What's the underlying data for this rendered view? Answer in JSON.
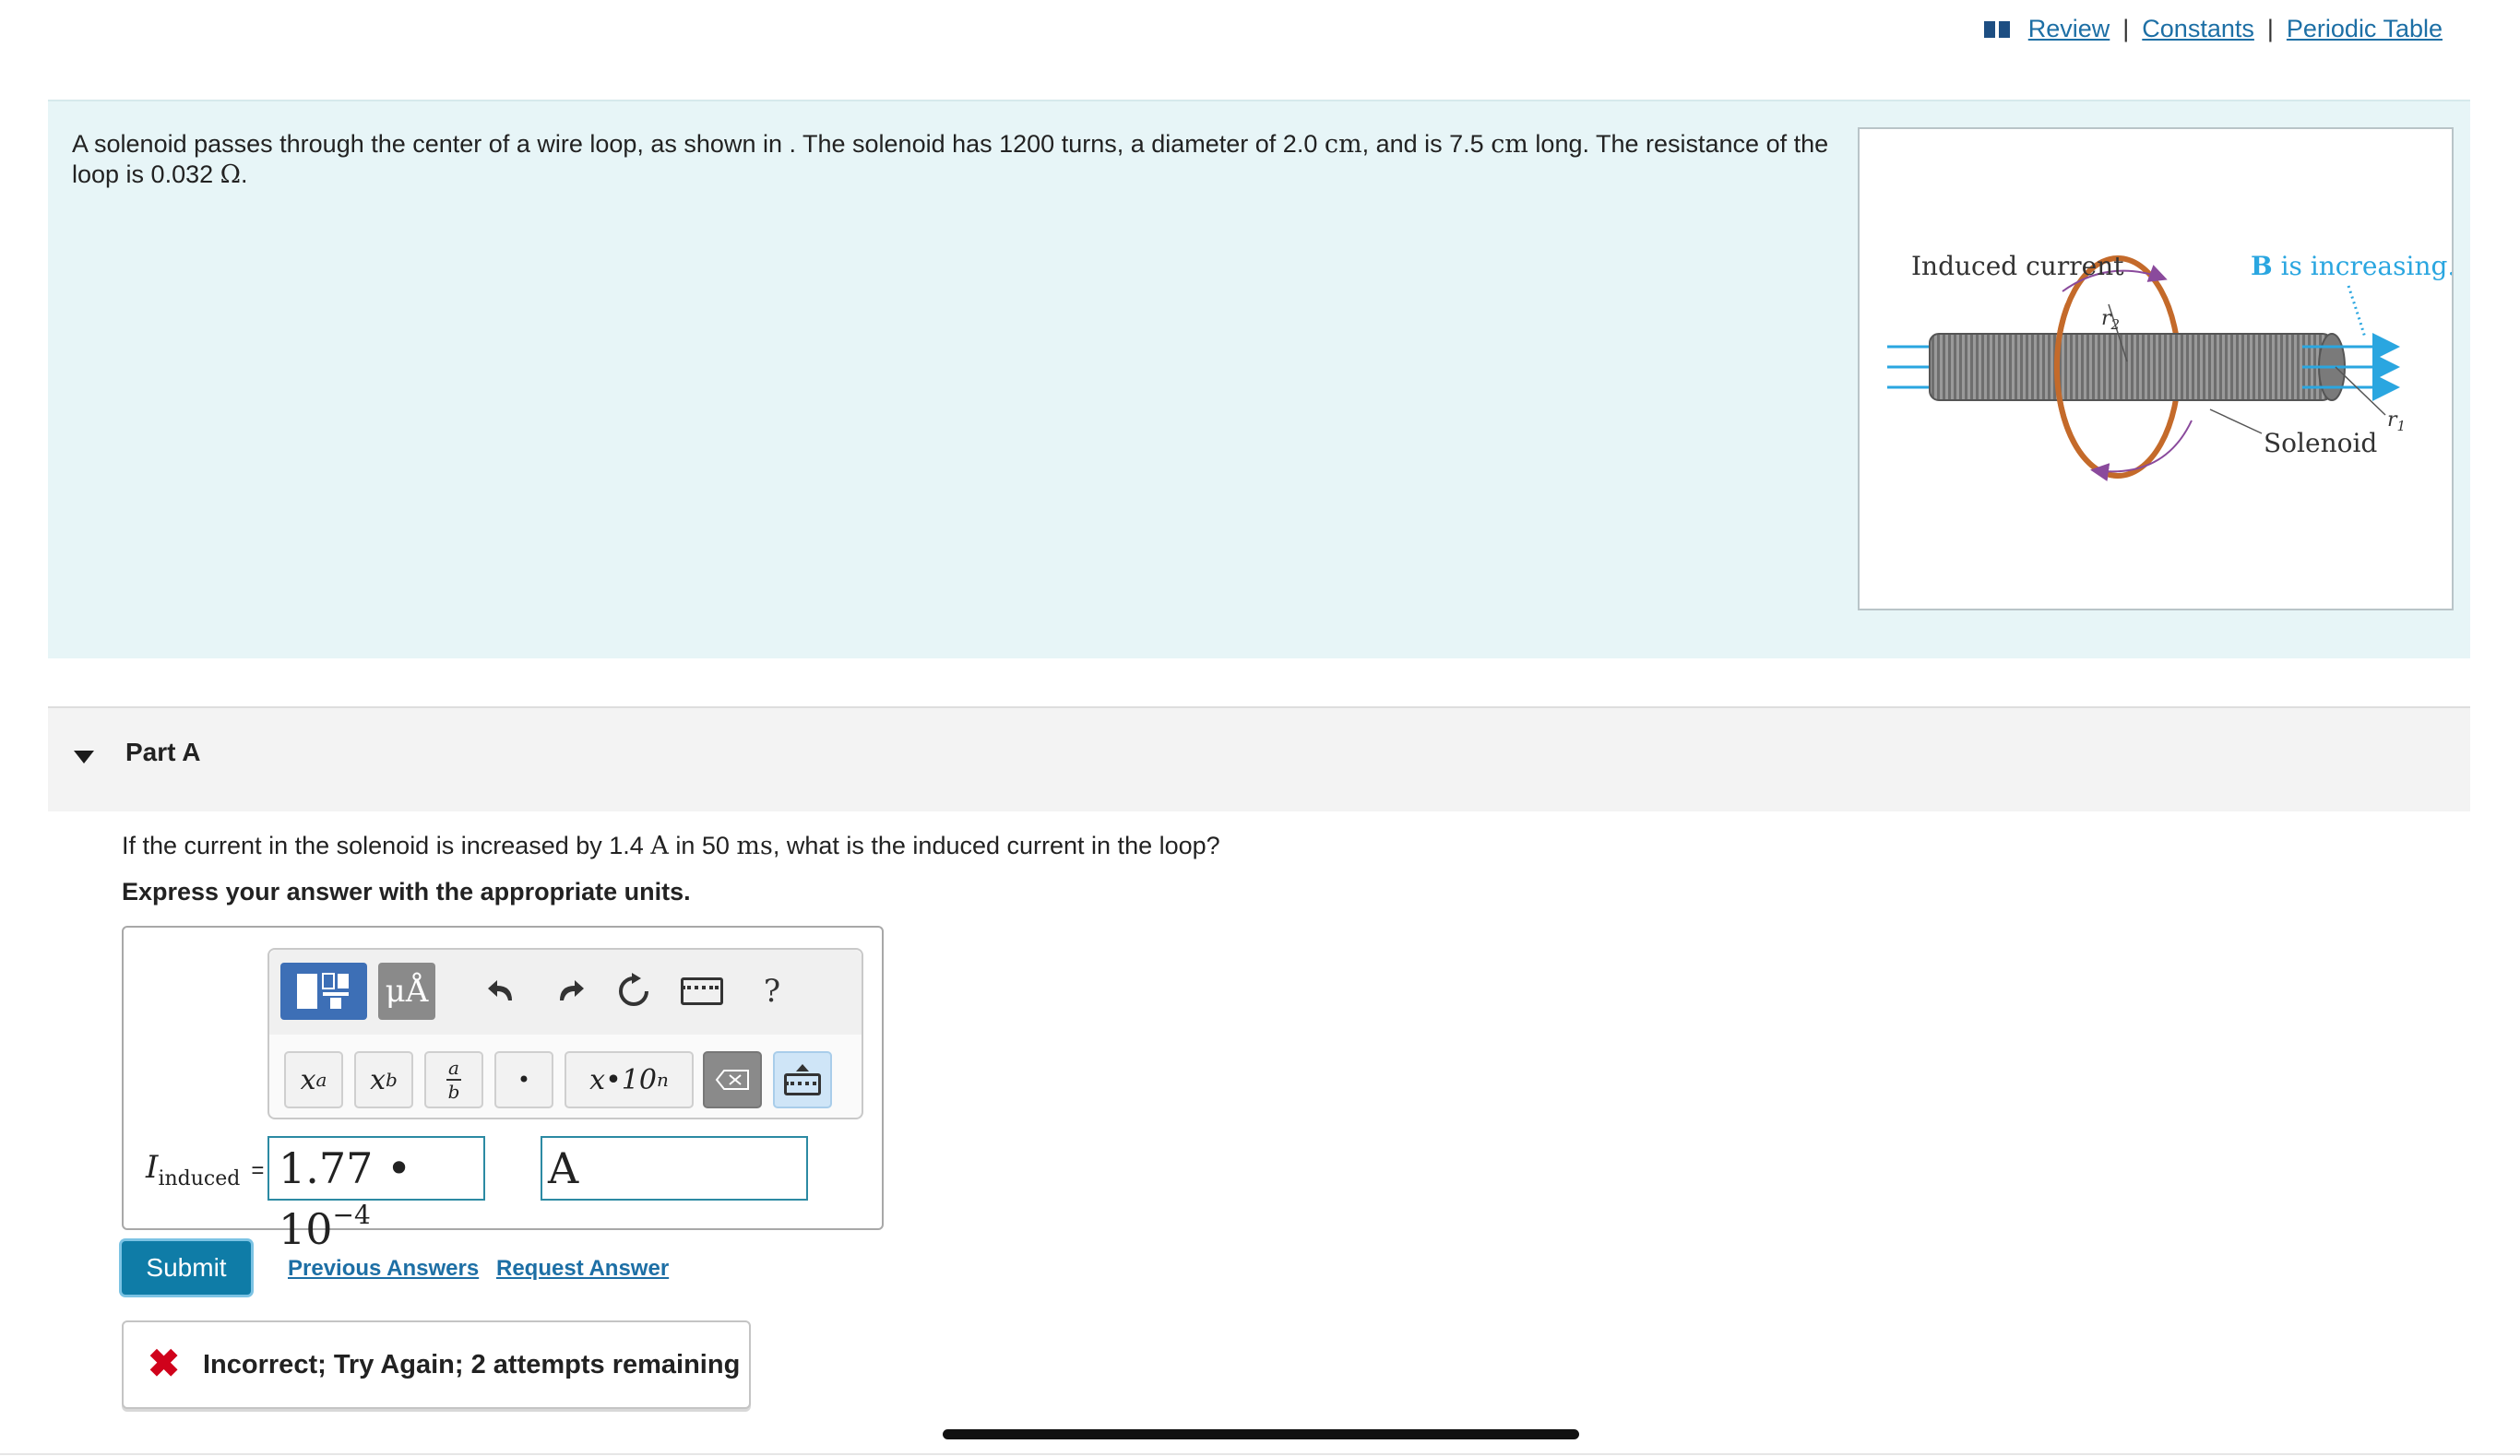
{
  "top_links": {
    "review": "Review",
    "constants": "Constants",
    "periodic_table": "Periodic Table"
  },
  "intro": {
    "text_a": "A solenoid passes through the center of a wire loop, as shown in . The solenoid has 1200 turns, a diameter of 2.0 ",
    "unit_cm1": "cm",
    "text_b": ", and is 7.5 ",
    "unit_cm2": "cm",
    "text_c": " long. The resistance of the loop is 0.032 ",
    "unit_ohm": "Ω",
    "text_d": "."
  },
  "figure": {
    "label_induced": "Induced current",
    "label_b_vec": "B",
    "label_b_rest": " is increasing.",
    "label_r2": "r",
    "label_r2_sub": "2",
    "label_r1": "r",
    "label_r1_sub": "1",
    "label_solenoid": "Solenoid",
    "colors": {
      "loop": "#c46a2a",
      "field": "#2aa6e0",
      "arrow": "#8a4a9c",
      "coil": "#8f8f8f"
    }
  },
  "part": {
    "title": "Part A",
    "question_a": "If the current in the solenoid is increased by 1.4 ",
    "unit_A": "A",
    "question_b": " in 50 ",
    "unit_ms": "ms",
    "question_c": ", what is the induced current in the loop?",
    "instruction": "Express your answer with the appropriate units."
  },
  "toolbar": {
    "units_label": "μÅ",
    "help_label": "?",
    "superscript_label": "x",
    "superscript_sup": "a",
    "subscript_label": "x",
    "subscript_sub": "b",
    "fraction_num": "a",
    "fraction_den": "b",
    "dot_label": "•",
    "sci_label": "x•10",
    "sci_sup": "n"
  },
  "answer": {
    "label_main": "I",
    "label_sub": "induced",
    "label_eq": "=",
    "value_mantissa": "1.77 • 10",
    "value_exponent": "−4",
    "unit": "A"
  },
  "actions": {
    "submit": "Submit",
    "previous_answers": "Previous Answers",
    "request_answer": "Request Answer"
  },
  "feedback": {
    "message": "Incorrect; Try Again; 2 attempts remaining"
  }
}
